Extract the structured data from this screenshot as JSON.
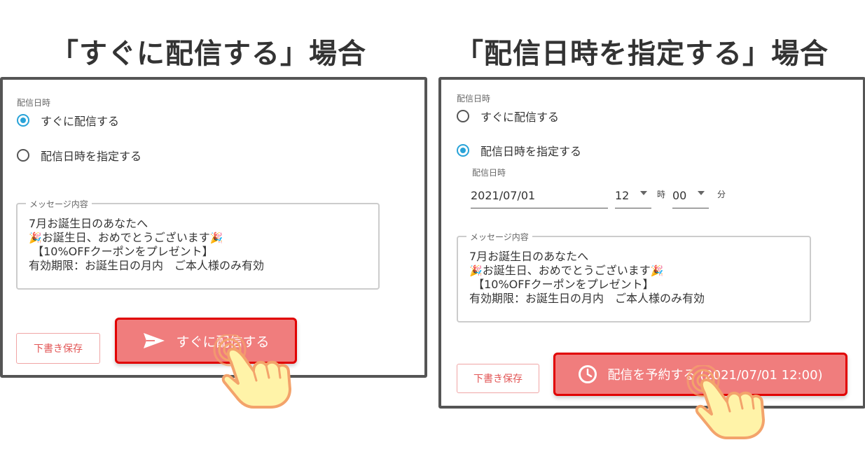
{
  "left": {
    "heading": "「すぐに配信する」場合",
    "date_label": "配信日時",
    "option_now": "すぐに配信する",
    "option_scheduled": "配信日時を指定する",
    "selected": "now",
    "message_legend": "メッセージ内容",
    "message_line1": "7月お誕生日のあなたへ",
    "message_line2": "お誕生日、おめでとうございます",
    "message_line3": "【10%OFFクーポンをプレゼント】",
    "message_line4": "有効期限：お誕生日の月内　ご本人様のみ有効",
    "draft_label": "下書き保存",
    "send_label": "すぐに配信する",
    "send_icon": "send-icon"
  },
  "right": {
    "heading": "「配信日時を指定する」場合",
    "date_label": "配信日時",
    "option_now": "すぐに配信する",
    "option_scheduled": "配信日時を指定する",
    "selected": "scheduled",
    "sub_date_label": "配信日時",
    "date_value": "2021/07/01",
    "hour_value": "12",
    "hour_unit": "時",
    "minute_value": "00",
    "minute_unit": "分",
    "message_legend": "メッセージ内容",
    "message_line1": "7月お誕生日のあなたへ",
    "message_line2": "お誕生日、おめでとうございます",
    "message_line3": "【10%OFFクーポンをプレゼント】",
    "message_line4": "有効期限：お誕生日の月内　ご本人様のみ有効",
    "draft_label": "下書き保存",
    "send_label": "配信を予約する (2021/07/01 12:00)",
    "send_icon": "clock-icon"
  },
  "colors": {
    "radio_accent": "#29a3d8",
    "send_fill": "#f07d7d",
    "send_border": "#e10000",
    "draft_text": "#e25555"
  },
  "cursor_icon": "pointing-hand-icon"
}
